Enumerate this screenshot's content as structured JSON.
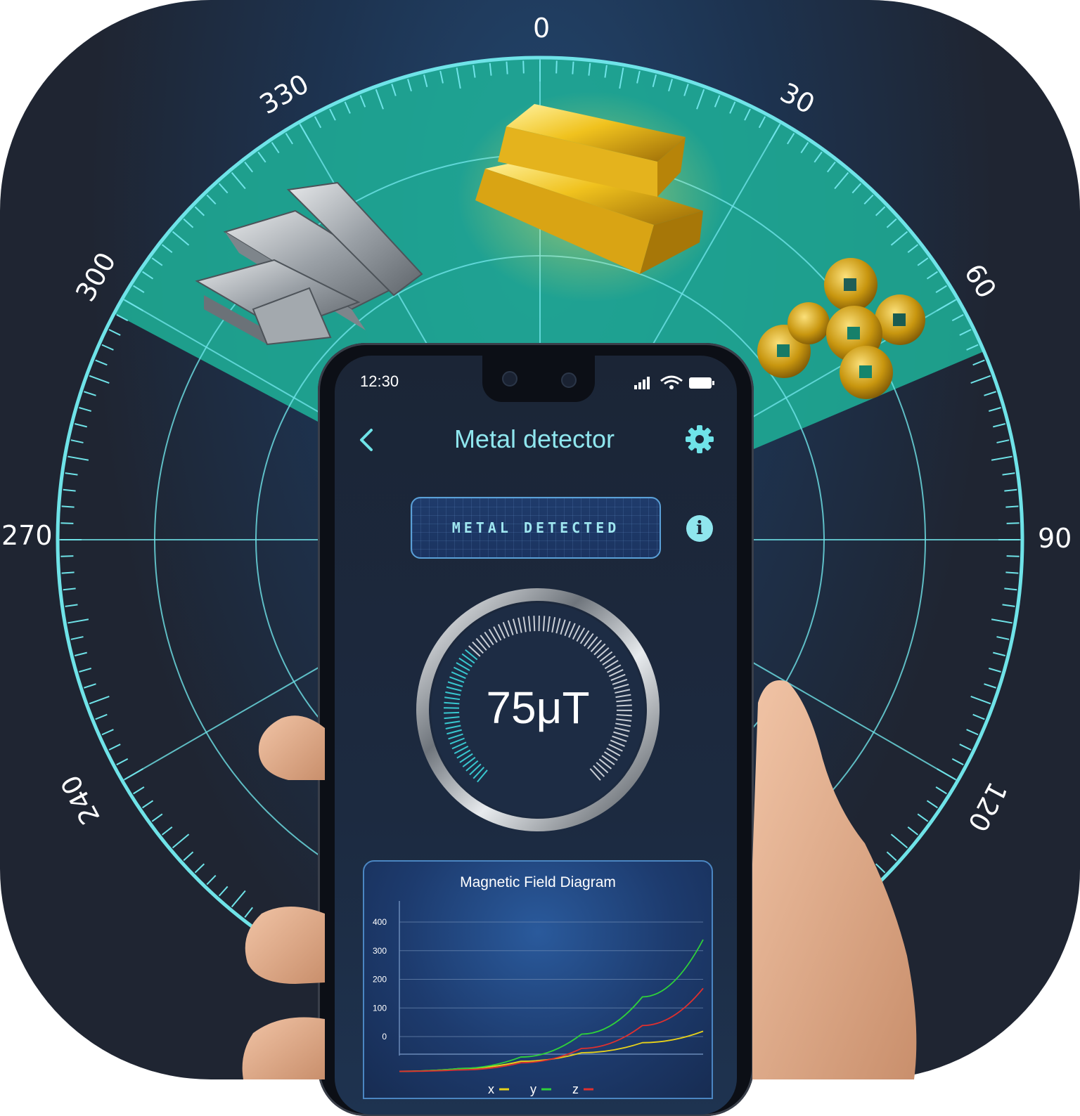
{
  "radar": {
    "degree_labels": [
      "0",
      "30",
      "60",
      "90",
      "120",
      "240",
      "270",
      "300",
      "330"
    ]
  },
  "status_bar": {
    "time": "12:30"
  },
  "header": {
    "title": "Metal detector",
    "back_icon": "chevron-left-icon",
    "settings_icon": "gear-icon"
  },
  "detection": {
    "status": "METAL DETECTED",
    "info_icon": "info-icon"
  },
  "gauge": {
    "value": "75μT"
  },
  "chart": {
    "title": "Magnetic Field Diagram"
  },
  "chart_data": {
    "type": "line",
    "title": "Magnetic Field Diagram",
    "yticks": [
      "400",
      "300",
      "200",
      "100",
      "0"
    ],
    "ylim": [
      0,
      400
    ],
    "xlim": [
      0,
      1
    ],
    "legend": [
      "x",
      "y",
      "z"
    ],
    "series": [
      {
        "name": "x",
        "color": "#e8d21a",
        "x": [
          0,
          0.2,
          0.4,
          0.6,
          0.8,
          1.0
        ],
        "values": [
          -60,
          -50,
          -25,
          5,
          40,
          80
        ]
      },
      {
        "name": "y",
        "color": "#2fd13a",
        "x": [
          0,
          0.2,
          0.4,
          0.6,
          0.8,
          1.0
        ],
        "values": [
          -60,
          -50,
          -10,
          70,
          200,
          400
        ]
      },
      {
        "name": "z",
        "color": "#e0302e",
        "x": [
          0,
          0.2,
          0.4,
          0.6,
          0.8,
          1.0
        ],
        "values": [
          -60,
          -55,
          -30,
          20,
          100,
          230
        ]
      }
    ],
    "grid": true
  },
  "colors": {
    "accent": "#6fe3e8",
    "radar_fill": "#1fb39a",
    "background": "#1f2532"
  },
  "objects": [
    "steel-beams-image",
    "gold-bars-image",
    "gold-coins-image"
  ]
}
